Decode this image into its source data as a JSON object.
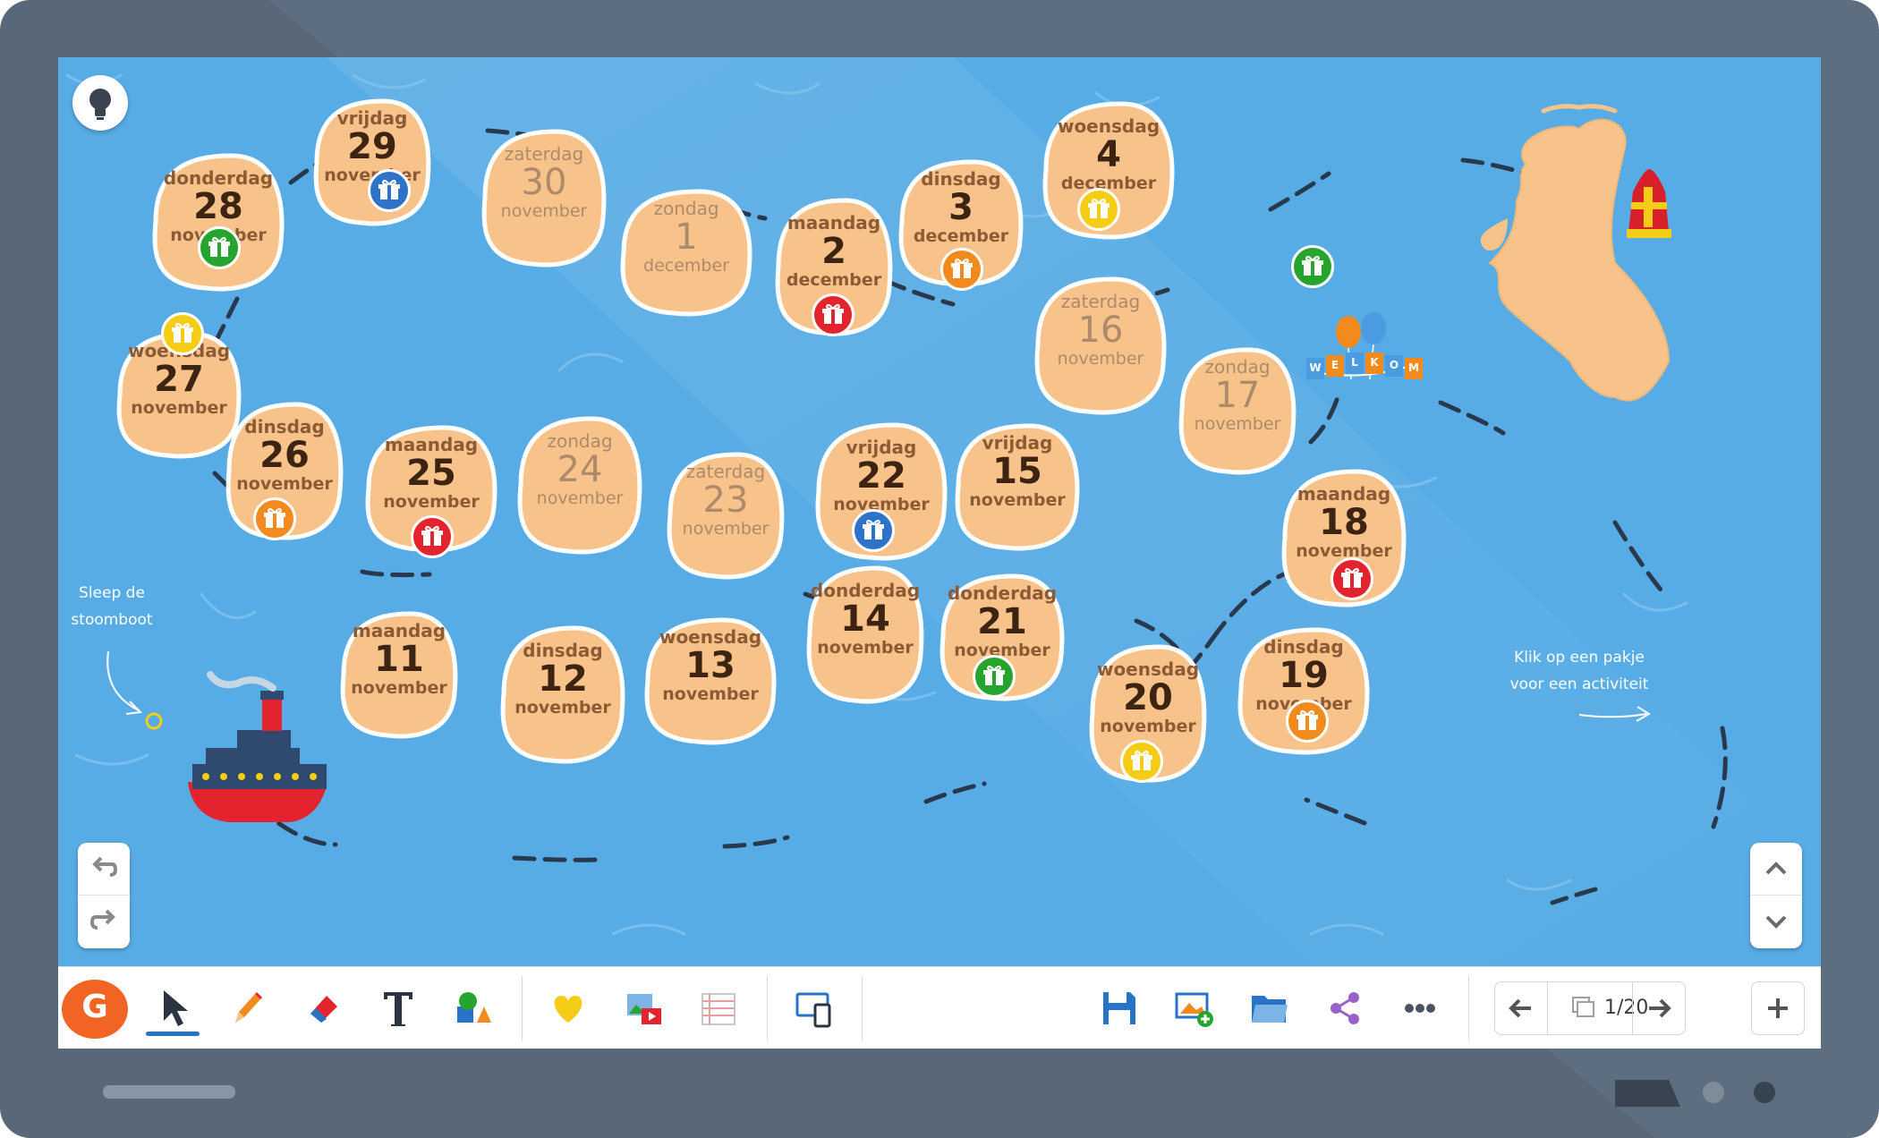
{
  "colors": {
    "frame": "#596878",
    "water": "#5aaee6",
    "island": "#f8c38a",
    "island_outline": "#ffffff",
    "gift_blue": "#2e73c8",
    "gift_green": "#26a52e",
    "gift_red": "#e3242e",
    "gift_orange": "#f28a1d",
    "gift_yellow": "#f6cd16",
    "toolbar_accent": "#2673c7",
    "logo": "#f26423"
  },
  "board": {
    "hint_boat": "Sleep de\nstoomboot",
    "hint_gift": "Klik op een pakje\nvoor een activiteit",
    "banner_letters": [
      "W",
      "E",
      "L",
      "K",
      "O",
      "M"
    ],
    "islands": [
      {
        "id": "11-nov",
        "day": "maandag",
        "num": "11",
        "month": "november",
        "gift": null,
        "faded": false
      },
      {
        "id": "12-nov",
        "day": "dinsdag",
        "num": "12",
        "month": "november",
        "gift": null,
        "faded": false
      },
      {
        "id": "13-nov",
        "day": "woensdag",
        "num": "13",
        "month": "november",
        "gift": null,
        "faded": false
      },
      {
        "id": "14-nov",
        "day": "donderdag",
        "num": "14",
        "month": "november",
        "gift": null,
        "faded": false
      },
      {
        "id": "15-nov",
        "day": "vrijdag",
        "num": "15",
        "month": "november",
        "gift": null,
        "faded": false
      },
      {
        "id": "16-nov",
        "day": "zaterdag",
        "num": "16",
        "month": "november",
        "gift": null,
        "faded": true
      },
      {
        "id": "17-nov",
        "day": "zondag",
        "num": "17",
        "month": "november",
        "gift": null,
        "faded": true
      },
      {
        "id": "18-nov",
        "day": "maandag",
        "num": "18",
        "month": "november",
        "gift": "red",
        "faded": false
      },
      {
        "id": "19-nov",
        "day": "dinsdag",
        "num": "19",
        "month": "november",
        "gift": "orange",
        "faded": false
      },
      {
        "id": "20-nov",
        "day": "woensdag",
        "num": "20",
        "month": "november",
        "gift": "yellow",
        "faded": false
      },
      {
        "id": "21-nov",
        "day": "donderdag",
        "num": "21",
        "month": "november",
        "gift": "green",
        "faded": false
      },
      {
        "id": "22-nov",
        "day": "vrijdag",
        "num": "22",
        "month": "november",
        "gift": "blue",
        "faded": false
      },
      {
        "id": "23-nov",
        "day": "zaterdag",
        "num": "23",
        "month": "november",
        "gift": null,
        "faded": true
      },
      {
        "id": "24-nov",
        "day": "zondag",
        "num": "24",
        "month": "november",
        "gift": null,
        "faded": true
      },
      {
        "id": "25-nov",
        "day": "maandag",
        "num": "25",
        "month": "november",
        "gift": "red",
        "faded": false
      },
      {
        "id": "26-nov",
        "day": "dinsdag",
        "num": "26",
        "month": "november",
        "gift": "orange",
        "faded": false
      },
      {
        "id": "27-nov",
        "day": "woensdag",
        "num": "27",
        "month": "november",
        "gift": "yellow",
        "faded": false
      },
      {
        "id": "28-nov",
        "day": "donderdag",
        "num": "28",
        "month": "november",
        "gift": "green",
        "faded": false
      },
      {
        "id": "29-nov",
        "day": "vrijdag",
        "num": "29",
        "month": "november",
        "gift": "blue",
        "faded": false
      },
      {
        "id": "30-nov",
        "day": "zaterdag",
        "num": "30",
        "month": "november",
        "gift": null,
        "faded": true
      },
      {
        "id": "1-dec",
        "day": "zondag",
        "num": "1",
        "month": "december",
        "gift": null,
        "faded": true
      },
      {
        "id": "2-dec",
        "day": "maandag",
        "num": "2",
        "month": "december",
        "gift": "red",
        "faded": false
      },
      {
        "id": "3-dec",
        "day": "dinsdag",
        "num": "3",
        "month": "december",
        "gift": "orange",
        "faded": false
      },
      {
        "id": "4-dec",
        "day": "woensdag",
        "num": "4",
        "month": "december",
        "gift": "yellow",
        "faded": false
      },
      {
        "id": "map",
        "day": "",
        "num": "",
        "month": "",
        "gift": "green",
        "faded": false
      }
    ]
  },
  "toolbar": {
    "logo_letter": "G",
    "page_indicator": "1/20",
    "tools": [
      "select-tool",
      "pen-tool",
      "eraser-tool",
      "text-tool",
      "shapes-tool",
      "favorites-tool",
      "media-tool",
      "notes-tool",
      "screen-share-tool",
      "save-tool",
      "add-slide-tool",
      "open-folder-tool",
      "share-tool",
      "more-tool"
    ]
  }
}
